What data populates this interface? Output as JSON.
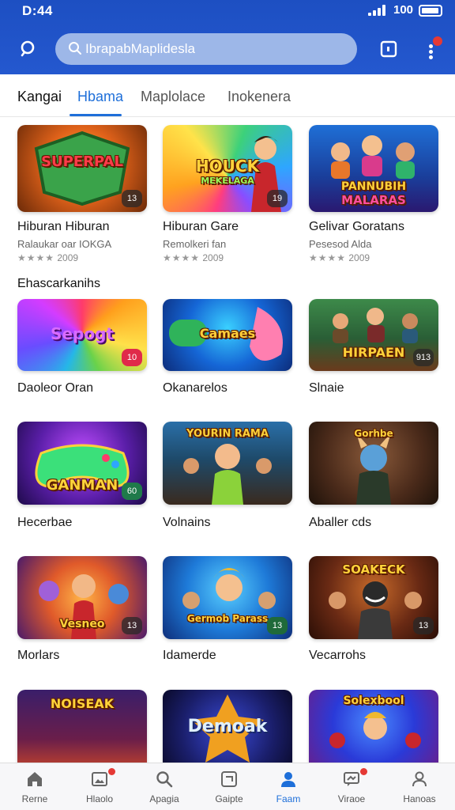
{
  "status": {
    "time": "D:44",
    "battery": "100"
  },
  "search": {
    "placeholder": "IbrapabMaplidesla"
  },
  "tabs": [
    {
      "label": "Kangai"
    },
    {
      "label": "Hbama"
    },
    {
      "label": "Maplolace"
    },
    {
      "label": "Inokenera"
    }
  ],
  "featured": [
    {
      "name": "Hiburan Hiburan",
      "sub": "Ralaukar oar IOKGA",
      "rating_text": "2009",
      "stars": "★★★★",
      "art_title": "SUPERPAL",
      "art_title2": "",
      "badge": "13"
    },
    {
      "name": "Hiburan Gare",
      "sub": "Remolkeri fan",
      "rating_text": "2009",
      "stars": "★★★★",
      "art_title": "HOUCK",
      "art_title2": "MEKELAGA",
      "badge": "19"
    },
    {
      "name": "Gelivar Goratans",
      "sub": "Pesesod Alda",
      "rating_text": "2009",
      "stars": "★★★★",
      "art_title": "PANNUBIH",
      "art_title2": "MALARAS",
      "badge": ""
    }
  ],
  "section": {
    "title": "Ehascarkanihs"
  },
  "grid": [
    {
      "name": "Daoleor Oran",
      "art_title": "Sepogt",
      "badge": "10"
    },
    {
      "name": "Okanarelos",
      "art_title": "Camaes",
      "badge": ""
    },
    {
      "name": "Slnaie",
      "art_title": "HIRPAEN",
      "badge": "913"
    },
    {
      "name": "Hecerbae",
      "art_title": "GANMAN",
      "badge": "60"
    },
    {
      "name": "Volnains",
      "art_title": "YOURIN RAMA",
      "badge": ""
    },
    {
      "name": "Aballer cds",
      "art_title": "Gorhbe",
      "badge": ""
    },
    {
      "name": "Morlars",
      "art_title": "Vesneo",
      "badge": "13"
    },
    {
      "name": "Idamerde",
      "art_title": "Germob Parass",
      "badge": "13"
    },
    {
      "name": "Vecarrohs",
      "art_title": "SOAKECK",
      "badge": "13"
    },
    {
      "name": "",
      "art_title": "NOISEAK",
      "badge": ""
    },
    {
      "name": "",
      "art_title": "Demoak",
      "badge": ""
    },
    {
      "name": "",
      "art_title": "Solexbool",
      "badge": ""
    }
  ],
  "nav": [
    {
      "label": "Rerne",
      "icon": "home-icon"
    },
    {
      "label": "Hlaolo",
      "icon": "photo-icon",
      "badge": true
    },
    {
      "label": "Apagia",
      "icon": "search-icon"
    },
    {
      "label": "Gaipte",
      "icon": "square-icon"
    },
    {
      "label": "Faam",
      "icon": "person-icon",
      "active": true
    },
    {
      "label": "Viraoe",
      "icon": "chat-icon",
      "badge": true
    },
    {
      "label": "Hanoas",
      "icon": "user-icon"
    }
  ],
  "colors": {
    "header": "#2458cf",
    "accent": "#1e6fd9",
    "badge": "#e53935"
  }
}
